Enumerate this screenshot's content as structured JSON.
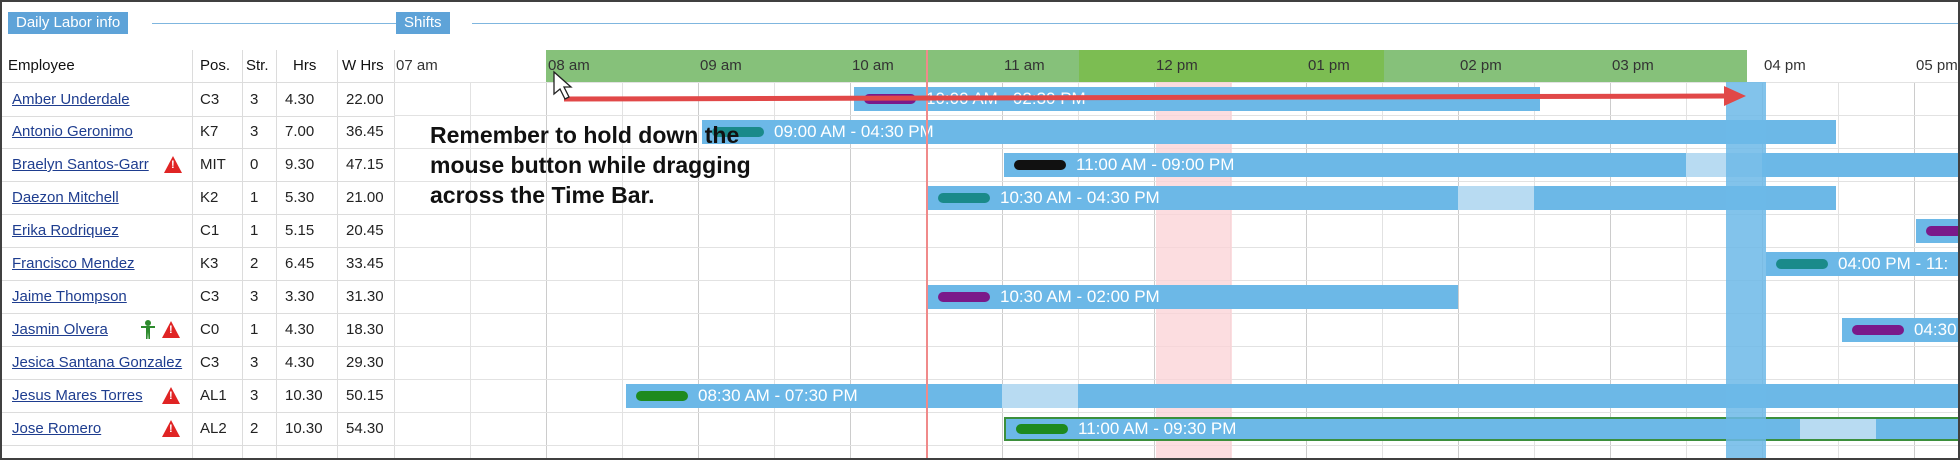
{
  "tabs": {
    "daily_labor": "Daily Labor info",
    "shifts": "Shifts"
  },
  "columns": {
    "employee": "Employee",
    "pos": "Pos.",
    "str": "Str.",
    "hrs": "Hrs",
    "whrs": "W Hrs"
  },
  "time_labels": [
    "07 am",
    "08 am",
    "09 am",
    "10 am",
    "11 am",
    "12 pm",
    "01 pm",
    "02 pm",
    "03 pm",
    "04 pm",
    "05 pm"
  ],
  "employees": [
    {
      "name": "Amber Underdale",
      "pos": "C3",
      "str": "3",
      "hrs": "4.30",
      "whrs": "22.00"
    },
    {
      "name": "Antonio Geronimo",
      "pos": "K7",
      "str": "3",
      "hrs": "7.00",
      "whrs": "36.45"
    },
    {
      "name": "Braelyn Santos-Garr",
      "pos": "MIT",
      "str": "0",
      "hrs": "9.30",
      "whrs": "47.15"
    },
    {
      "name": "Daezon Mitchell",
      "pos": "K2",
      "str": "1",
      "hrs": "5.30",
      "whrs": "21.00"
    },
    {
      "name": "Erika Rodriquez",
      "pos": "C1",
      "str": "1",
      "hrs": "5.15",
      "whrs": "20.45"
    },
    {
      "name": "Francisco Mendez",
      "pos": "K3",
      "str": "2",
      "hrs": "6.45",
      "whrs": "33.45"
    },
    {
      "name": "Jaime Thompson",
      "pos": "C3",
      "str": "3",
      "hrs": "3.30",
      "whrs": "31.30"
    },
    {
      "name": "Jasmin Olvera",
      "pos": "C0",
      "str": "1",
      "hrs": "4.30",
      "whrs": "18.30"
    },
    {
      "name": "Jesica Santana Gonzalez",
      "pos": "C3",
      "str": "3",
      "hrs": "4.30",
      "whrs": "29.30"
    },
    {
      "name": "Jesus Mares Torres",
      "pos": "AL1",
      "str": "3",
      "hrs": "10.30",
      "whrs": "50.15"
    },
    {
      "name": "Jose Romero",
      "pos": "AL2",
      "str": "2",
      "hrs": "10.30",
      "whrs": "54.30"
    }
  ],
  "shifts": {
    "amber": "10:00 AM - 02:30 PM",
    "antonio": "09:00 AM - 04:30 PM",
    "braelyn": "11:00 AM - 09:00 PM",
    "daezon": "10:30 AM - 04:30 PM",
    "francisco": "04:00 PM - 11:",
    "jaime": "10:30 AM - 02:00 PM",
    "jasmin": "04:30",
    "jesus": "08:30 AM - 07:30 PM",
    "jose": "11:00 AM - 09:30 PM"
  },
  "annotation": "Remember to hold down the mouse button while dragging across the Time Bar.",
  "colors": {
    "teal": "#1a8a8a",
    "black": "#111111",
    "purple": "#7a1a8a",
    "green": "#1e8a1e",
    "shift_blue": "#6cb8e7",
    "timebar_green": "#7cc06c",
    "arrow_red": "#e14848"
  }
}
